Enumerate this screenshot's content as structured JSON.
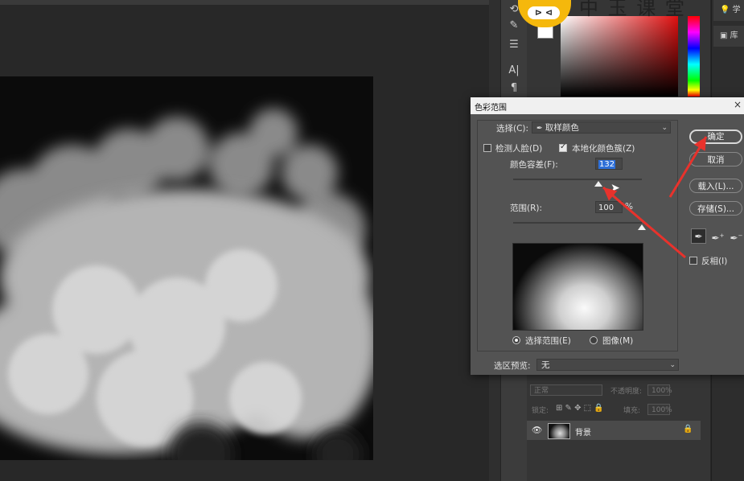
{
  "dialog": {
    "title": "色彩范围",
    "close_glyph": "×",
    "select_label": "选择(C):",
    "select_value": "取样颜色",
    "select_icon": "eyedropper-icon",
    "detect_faces_label": "检测人脸(D)",
    "detect_faces_checked": false,
    "localized_clusters_label": "本地化颜色簇(Z)",
    "localized_clusters_checked": true,
    "fuzziness_label": "颜色容差(F):",
    "fuzziness_value": "132",
    "fuzziness_fraction": 0.66,
    "range_label": "范围(R):",
    "range_value": "100",
    "range_unit": "%",
    "range_fraction": 1.0,
    "radio_selection_label": "选择范围(E)",
    "radio_image_label": "图像(M)",
    "radio_selected": "selection",
    "preview_label": "选区预览:",
    "preview_value": "无",
    "buttons": {
      "ok": "确定",
      "cancel": "取消",
      "load": "载入(L)...",
      "save": "存储(S)..."
    },
    "eyedropper_icons": [
      "eyedropper-icon",
      "eyedropper-plus-icon",
      "eyedropper-minus-icon"
    ],
    "invert_label": "反相(I)",
    "invert_checked": false
  },
  "layers": {
    "blend_mode": "正常",
    "opacity_label": "不透明度:",
    "opacity_value": "100%",
    "lock_label": "锁定:",
    "fill_label": "填充:",
    "fill_value": "100%",
    "layer_name": "背景"
  },
  "far_right": {
    "item1": "学",
    "item2": "库"
  },
  "watermark": "中 玉 课 堂",
  "colors": {
    "annotation_arrow": "#e8322c",
    "dialog_bg": "#535353",
    "highlight": "#2e6fd8"
  }
}
